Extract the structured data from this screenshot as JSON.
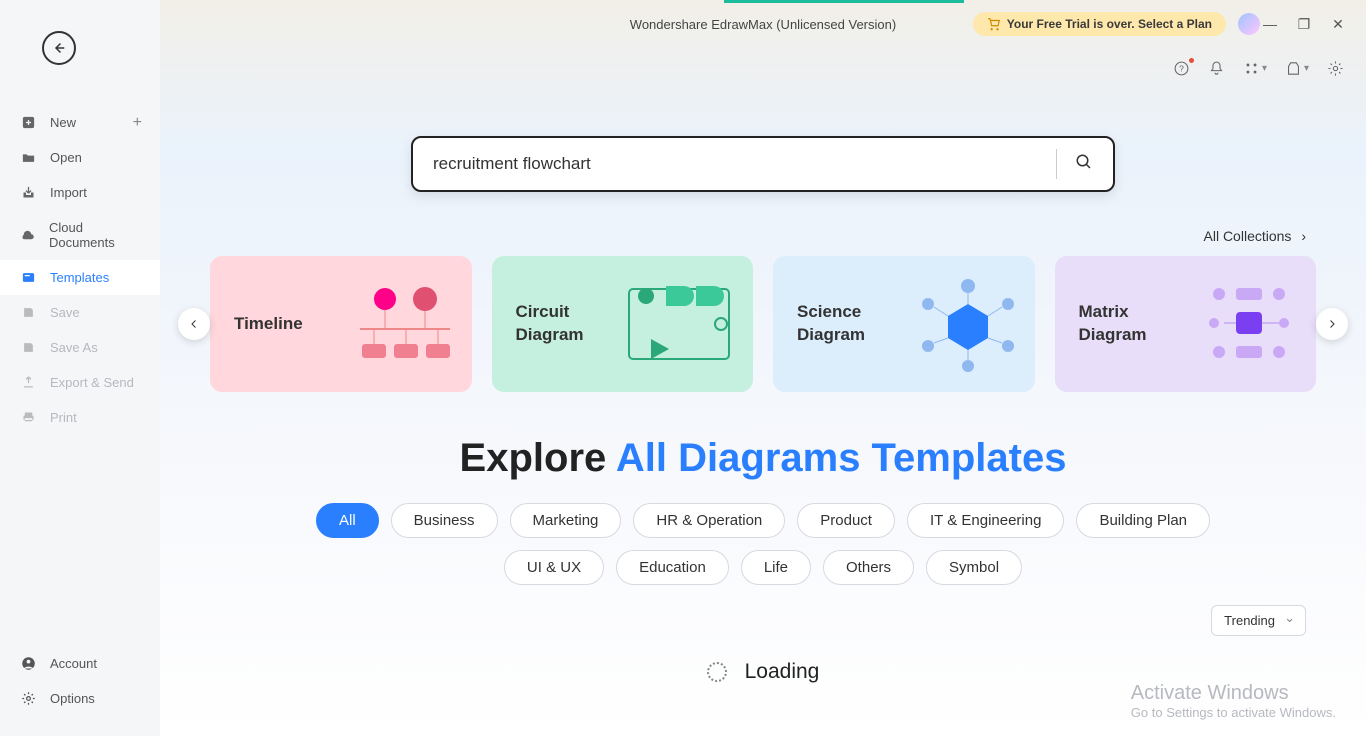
{
  "titlebar": {
    "app_title": "Wondershare EdrawMax (Unlicensed Version)",
    "trial_text": "Your Free Trial is over. Select a Plan"
  },
  "sidebar": {
    "items": [
      {
        "label": "New"
      },
      {
        "label": "Open"
      },
      {
        "label": "Import"
      },
      {
        "label": "Cloud Documents"
      },
      {
        "label": "Templates"
      },
      {
        "label": "Save"
      },
      {
        "label": "Save As"
      },
      {
        "label": "Export & Send"
      },
      {
        "label": "Print"
      }
    ],
    "account": "Account",
    "options": "Options"
  },
  "search": {
    "value": "recruitment flowchart"
  },
  "collections_link": "All Collections",
  "carousel": [
    {
      "label": "Timeline"
    },
    {
      "label": "Circuit Diagram"
    },
    {
      "label": "Science Diagram"
    },
    {
      "label": "Matrix Diagram"
    }
  ],
  "explore": {
    "prefix": "Explore ",
    "highlight": "All Diagrams Templates"
  },
  "pills": [
    "All",
    "Business",
    "Marketing",
    "HR & Operation",
    "Product",
    "IT & Engineering",
    "Building Plan",
    "UI & UX",
    "Education",
    "Life",
    "Others",
    "Symbol"
  ],
  "sort": {
    "selected": "Trending"
  },
  "loading": "Loading",
  "watermark": {
    "l1": "Activate Windows",
    "l2": "Go to Settings to activate Windows."
  }
}
